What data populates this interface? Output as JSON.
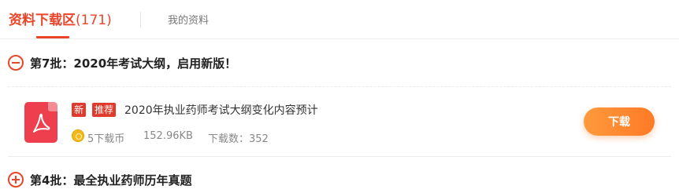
{
  "tabs": {
    "active_label": "资料下载区",
    "active_count": "(171)",
    "secondary_label": "我的资料"
  },
  "groups": [
    {
      "title": "第7批：2020年考试大纲，启用新版！",
      "expanded": true,
      "files": [
        {
          "type_icon": "pdf-icon",
          "badges": [
            "新",
            "推荐"
          ],
          "title": "2020年执业药师考试大纲变化内容预计",
          "price": "5下载币",
          "size": "152.96KB",
          "downloads": "下载数：352",
          "download_label": "下载"
        }
      ]
    },
    {
      "title": "第4批：最全执业药师历年真题",
      "expanded": false
    }
  ],
  "colors": {
    "accent": "#e8452a",
    "badge": "#e03a2c",
    "button": "#ff8a30",
    "pdf": "#ee3f4f"
  }
}
